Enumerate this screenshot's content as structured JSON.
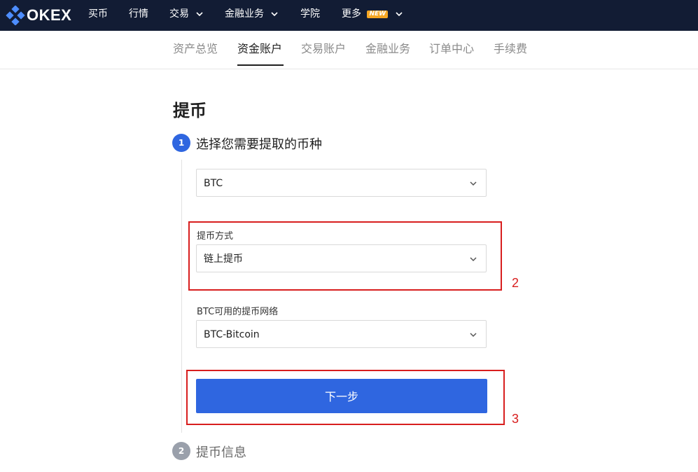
{
  "header": {
    "logo_text": "OKEX",
    "nav": [
      {
        "label": "买币"
      },
      {
        "label": "行情"
      },
      {
        "label": "交易"
      },
      {
        "label": "金融业务"
      },
      {
        "label": "学院"
      },
      {
        "label": "更多",
        "badge": "NEW"
      }
    ]
  },
  "subnav": {
    "tabs": [
      {
        "label": "资产总览"
      },
      {
        "label": "资金账户",
        "active": true
      },
      {
        "label": "交易账户"
      },
      {
        "label": "金融业务"
      },
      {
        "label": "订单中心"
      },
      {
        "label": "手续费"
      }
    ]
  },
  "page": {
    "title": "提币",
    "step1": {
      "number": "1",
      "label": "选择您需要提取的币种"
    },
    "step2": {
      "number": "2",
      "label": "提币信息"
    },
    "coin_select": {
      "value": "BTC"
    },
    "method": {
      "label": "提币方式",
      "value": "链上提币"
    },
    "network": {
      "label": "BTC可用的提币网络",
      "value": "BTC-Bitcoin"
    },
    "next_button": "下一步"
  },
  "annotations": {
    "box2_number": "2",
    "box3_number": "3"
  },
  "colors": {
    "topbar": "#121c34",
    "primary": "#2f66e0",
    "annotation": "#d81e1e",
    "badge": "#f5a623",
    "step_inactive": "#9aa0ab"
  }
}
